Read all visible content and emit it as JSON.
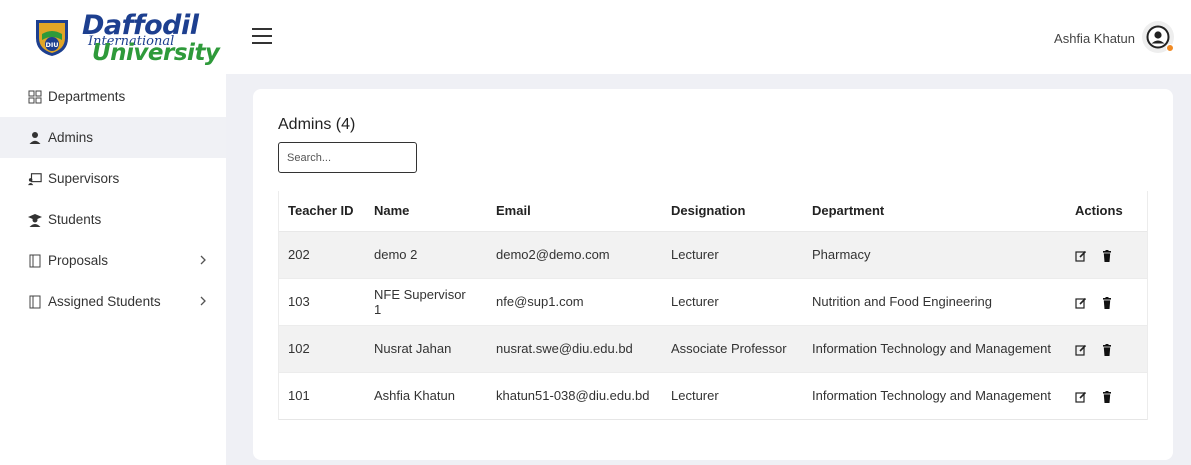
{
  "brand": {
    "line1": "Daffodil",
    "line2": "International",
    "line3": "University",
    "shield_text": "DIU",
    "colors": {
      "blue": "#1d3f8f",
      "green": "#2e9a3a",
      "gold": "#e0a526"
    }
  },
  "header": {
    "menu_icon": "hamburger-icon",
    "user_name": "Ashfia Khatun",
    "avatar_icon": "user-circle-icon",
    "status_color": "#f08a24"
  },
  "sidebar": {
    "items": [
      {
        "label": "Departments",
        "icon": "grid-icon",
        "active": false,
        "has_children": false
      },
      {
        "label": "Admins",
        "icon": "user-icon",
        "active": true,
        "has_children": false
      },
      {
        "label": "Supervisors",
        "icon": "presentation-icon",
        "active": false,
        "has_children": false
      },
      {
        "label": "Students",
        "icon": "graduate-icon",
        "active": false,
        "has_children": false
      },
      {
        "label": "Proposals",
        "icon": "document-icon",
        "active": false,
        "has_children": true
      },
      {
        "label": "Assigned Students",
        "icon": "document-icon",
        "active": false,
        "has_children": true
      }
    ]
  },
  "main": {
    "title": "Admins (4)",
    "search_placeholder": "Search...",
    "columns": [
      "Teacher ID",
      "Name",
      "Email",
      "Designation",
      "Department",
      "Actions"
    ],
    "rows": [
      {
        "id": "202",
        "name": "demo 2",
        "email": "demo2@demo.com",
        "designation": "Lecturer",
        "department": "Pharmacy"
      },
      {
        "id": "103",
        "name": "NFE Supervisor 1",
        "email": "nfe@sup1.com",
        "designation": "Lecturer",
        "department": "Nutrition and Food Engineering"
      },
      {
        "id": "102",
        "name": "Nusrat Jahan",
        "email": "nusrat.swe@diu.edu.bd",
        "designation": "Associate Professor",
        "department": "Information Technology and Management"
      },
      {
        "id": "101",
        "name": "Ashfia Khatun",
        "email": "khatun51-038@diu.edu.bd",
        "designation": "Lecturer",
        "department": "Information Technology and Management"
      }
    ],
    "action_icons": [
      "edit-icon",
      "trash-icon"
    ]
  }
}
